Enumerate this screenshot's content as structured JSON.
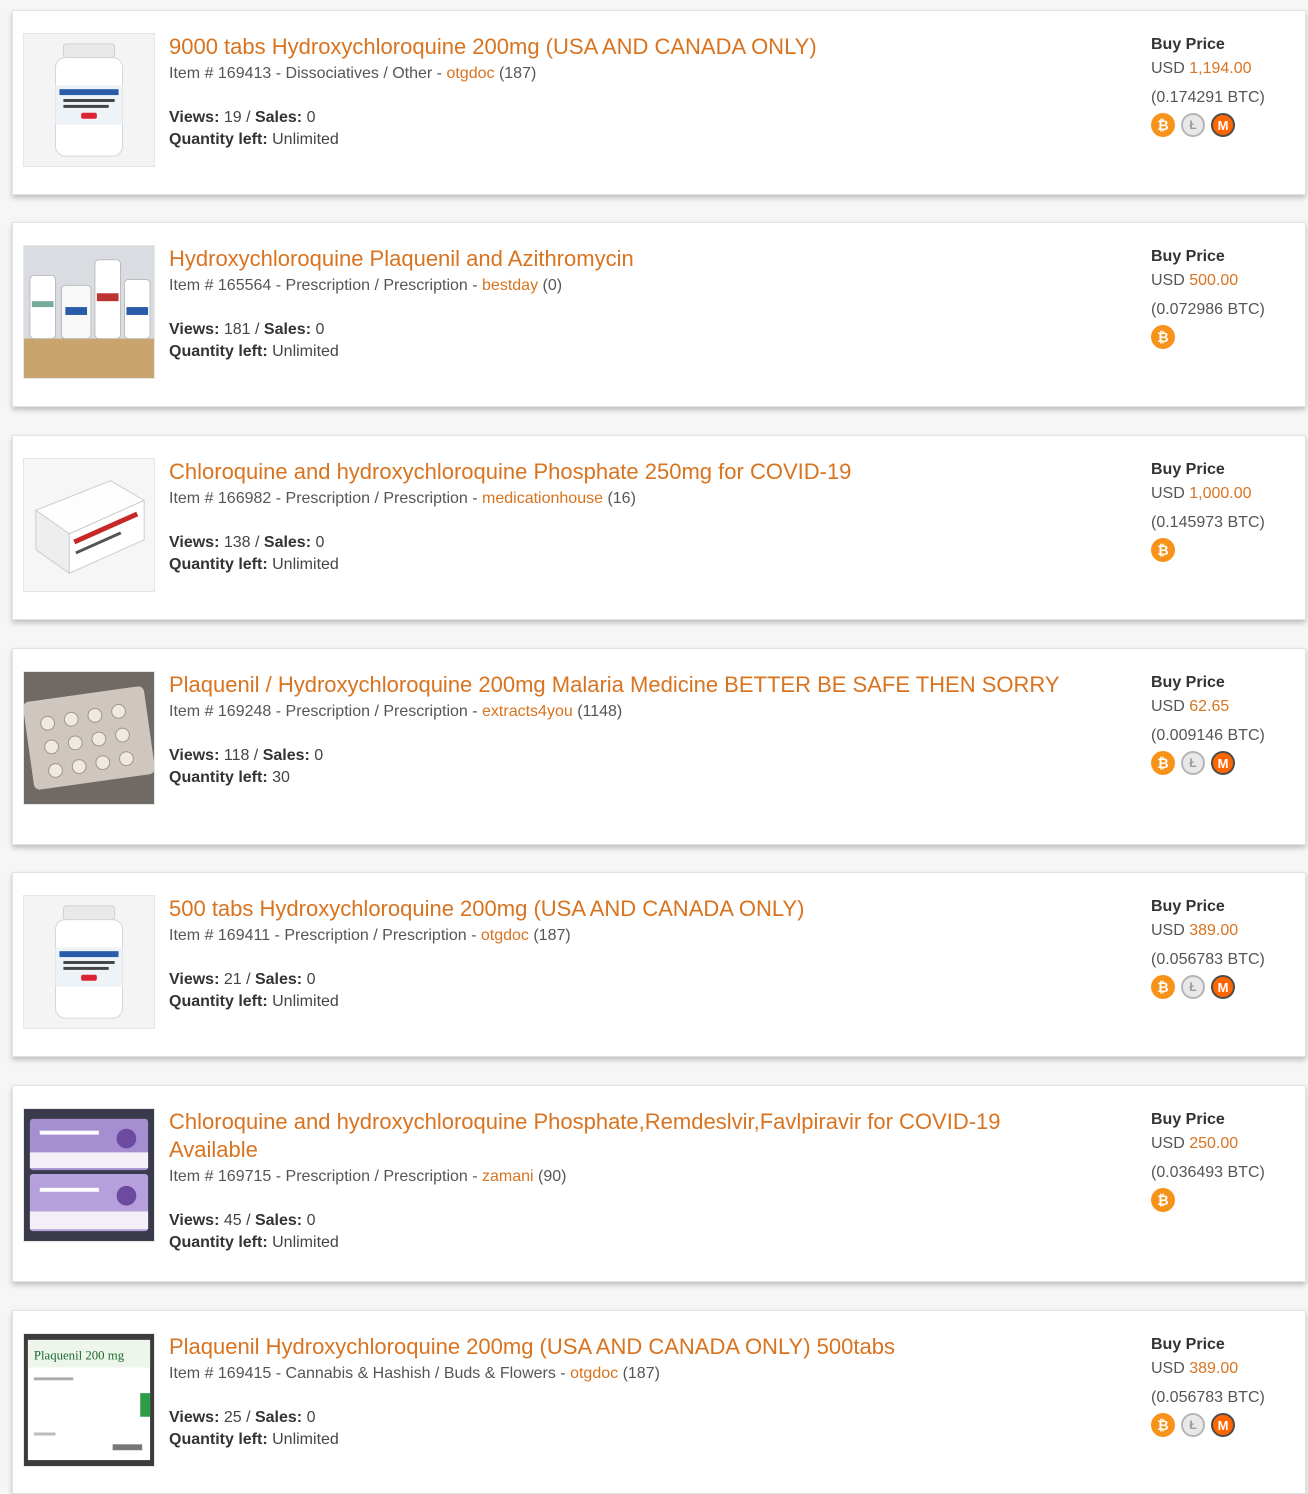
{
  "listings": [
    {
      "title": "9000 tabs Hydroxychloroquine 200mg (USA AND CANADA ONLY)",
      "item_prefix": "Item # 169413 - Dissociatives / Other - ",
      "vendor": "otgdoc",
      "vendor_count": " (187)",
      "views_label": "Views:",
      "views": " 19 / ",
      "sales_label": "Sales:",
      "sales": " 0",
      "qty_label": "Quantity left:",
      "qty": " Unlimited",
      "buy_price_label": "Buy Price",
      "usd_prefix": "USD ",
      "usd": "1,194.00",
      "btc": "(0.174291 BTC)",
      "coins": [
        "bitcoin",
        "litecoin",
        "monero"
      ],
      "image": "pill-bottle"
    },
    {
      "title": "Hydroxychloroquine Plaquenil and Azithromycin",
      "item_prefix": "Item # 165564 - Prescription / Prescription - ",
      "vendor": "bestday",
      "vendor_count": " (0)",
      "views_label": "Views:",
      "views": " 181 / ",
      "sales_label": "Sales:",
      "sales": " 0",
      "qty_label": "Quantity left:",
      "qty": " Unlimited",
      "buy_price_label": "Buy Price",
      "usd_prefix": "USD ",
      "usd": "500.00",
      "btc": "(0.072986 BTC)",
      "coins": [
        "bitcoin"
      ],
      "image": "bottles-shelf"
    },
    {
      "title": "Chloroquine and hydroxychloroquine Phosphate 250mg for COVID-19",
      "item_prefix": "Item # 166982 - Prescription / Prescription - ",
      "vendor": "medicationhouse",
      "vendor_count": " (16)",
      "views_label": "Views:",
      "views": " 138 / ",
      "sales_label": "Sales:",
      "sales": " 0",
      "qty_label": "Quantity left:",
      "qty": " Unlimited",
      "buy_price_label": "Buy Price",
      "usd_prefix": "USD ",
      "usd": "1,000.00",
      "btc": "(0.145973 BTC)",
      "coins": [
        "bitcoin"
      ],
      "image": "medicine-box"
    },
    {
      "title": "Plaquenil / Hydroxychloroquine 200mg Malaria Medicine BETTER BE SAFE THEN SORRY",
      "item_prefix": "Item # 169248 - Prescription / Prescription - ",
      "vendor": "extracts4you",
      "vendor_count": " (1148)",
      "views_label": "Views:",
      "views": " 118 / ",
      "sales_label": "Sales:",
      "sales": " 0",
      "qty_label": "Quantity left:",
      "qty": " 30",
      "buy_price_label": "Buy Price",
      "usd_prefix": "USD ",
      "usd": "62.65",
      "btc": "(0.009146 BTC)",
      "coins": [
        "bitcoin",
        "litecoin",
        "monero"
      ],
      "image": "blister-pack"
    },
    {
      "title": "500 tabs Hydroxychloroquine 200mg (USA AND CANADA ONLY)",
      "item_prefix": "Item # 169411 - Prescription / Prescription - ",
      "vendor": "otgdoc",
      "vendor_count": " (187)",
      "views_label": "Views:",
      "views": " 21 / ",
      "sales_label": "Sales:",
      "sales": " 0",
      "qty_label": "Quantity left:",
      "qty": " Unlimited",
      "buy_price_label": "Buy Price",
      "usd_prefix": "USD ",
      "usd": "389.00",
      "btc": "(0.056783 BTC)",
      "coins": [
        "bitcoin",
        "litecoin",
        "monero"
      ],
      "image": "pill-bottle"
    },
    {
      "title": "Chloroquine and hydroxychloroquine Phosphate,Remdeslvir,Favlpiravir for COVID-19 Available",
      "item_prefix": "Item # 169715 - Prescription / Prescription - ",
      "vendor": "zamani",
      "vendor_count": " (90)",
      "views_label": "Views:",
      "views": " 45 / ",
      "sales_label": "Sales:",
      "sales": " 0",
      "qty_label": "Quantity left:",
      "qty": " Unlimited",
      "buy_price_label": "Buy Price",
      "usd_prefix": "USD ",
      "usd": "250.00",
      "btc": "(0.036493 BTC)",
      "coins": [
        "bitcoin"
      ],
      "image": "purple-boxes"
    },
    {
      "title": "Plaquenil Hydroxychloroquine 200mg (USA AND CANADA ONLY) 500tabs",
      "item_prefix": "Item # 169415 - Cannabis & Hashish / Buds & Flowers - ",
      "vendor": "otgdoc",
      "vendor_count": " (187)",
      "views_label": "Views:",
      "views": " 25 / ",
      "sales_label": "Sales:",
      "sales": " 0",
      "qty_label": "Quantity left:",
      "qty": " Unlimited",
      "buy_price_label": "Buy Price",
      "usd_prefix": "USD ",
      "usd": "389.00",
      "btc": "(0.056783 BTC)",
      "coins": [
        "bitcoin",
        "litecoin",
        "monero"
      ],
      "image": "plaquenil-box",
      "image_text": "Plaquenil 200 mg"
    }
  ],
  "colors": {
    "accent": "#d8731f",
    "bitcoin": "#f7931a",
    "monero": "#ff6600",
    "litecoin": "#b5b5b5"
  },
  "coin_glyphs": {
    "bitcoin": "₿",
    "litecoin": "Ł",
    "monero": "M"
  }
}
